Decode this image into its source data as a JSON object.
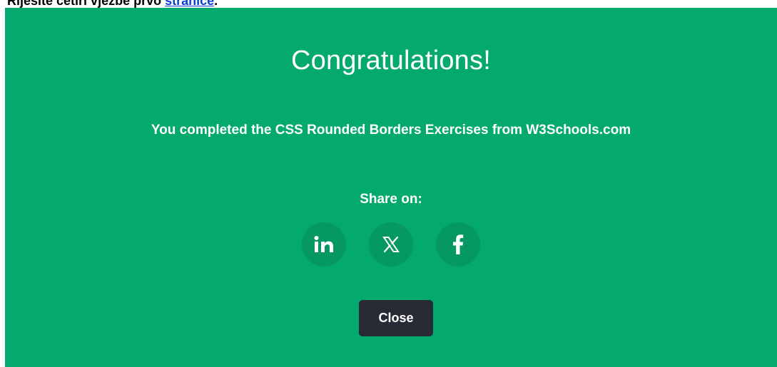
{
  "page": {
    "instruction_prefix": "Riješite četiri vježbe prvo ",
    "instruction_link": "stranice",
    "instruction_suffix": "."
  },
  "modal": {
    "title": "Congratulations!",
    "subtitle": "You completed the CSS Rounded Borders Exercises from W3Schools.com",
    "share_label": "Share on:",
    "social": [
      {
        "icon": "linkedin-icon",
        "glyph": "in"
      },
      {
        "icon": "x-icon",
        "glyph": "𝕏"
      },
      {
        "icon": "facebook-icon",
        "glyph": "f"
      }
    ],
    "close_label": "Close"
  },
  "colors": {
    "modal_background": "#04aa6d",
    "social_button_background": "#059862",
    "close_button_background": "#282a35",
    "link": "#0b3fd6"
  }
}
